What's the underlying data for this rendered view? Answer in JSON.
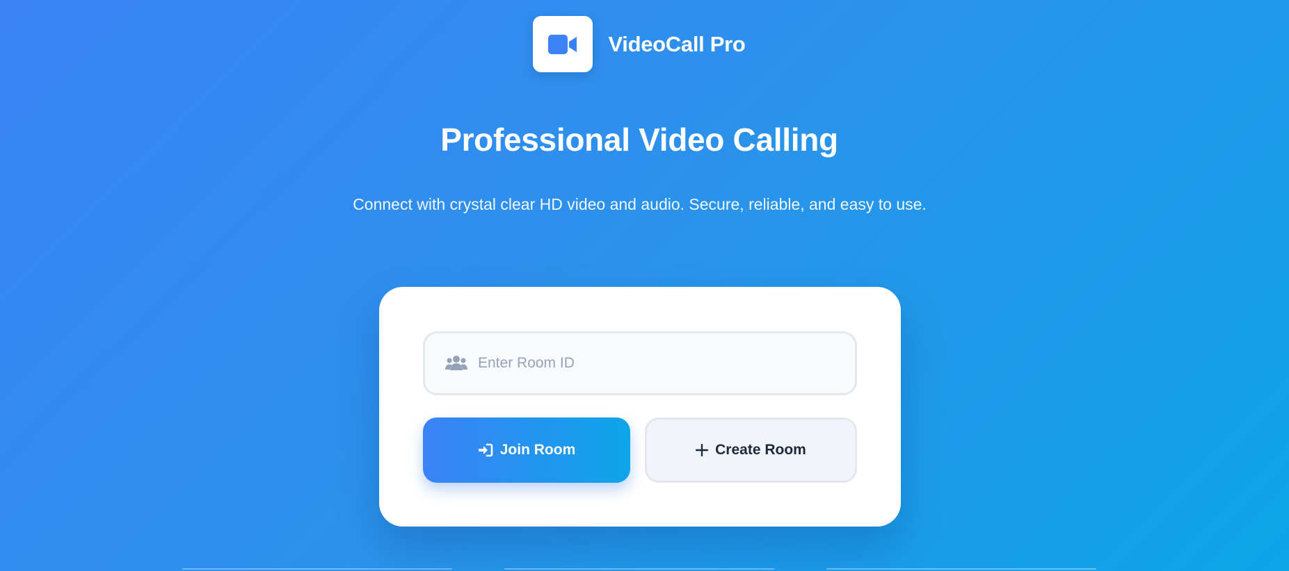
{
  "header": {
    "brand_name": "VideoCall Pro",
    "logo_icon": "video-camera-icon",
    "accent_color": "#3b82f6"
  },
  "hero": {
    "title": "Professional Video Calling",
    "subtitle": "Connect with crystal clear HD video and audio. Secure, reliable, and easy to use."
  },
  "room_form": {
    "room_input": {
      "placeholder": "Enter Room ID",
      "value": "",
      "icon": "users-icon"
    },
    "join_button": {
      "label": "Join Room",
      "icon": "sign-in-icon"
    },
    "create_button": {
      "label": "Create Room",
      "icon": "plus-icon"
    }
  }
}
